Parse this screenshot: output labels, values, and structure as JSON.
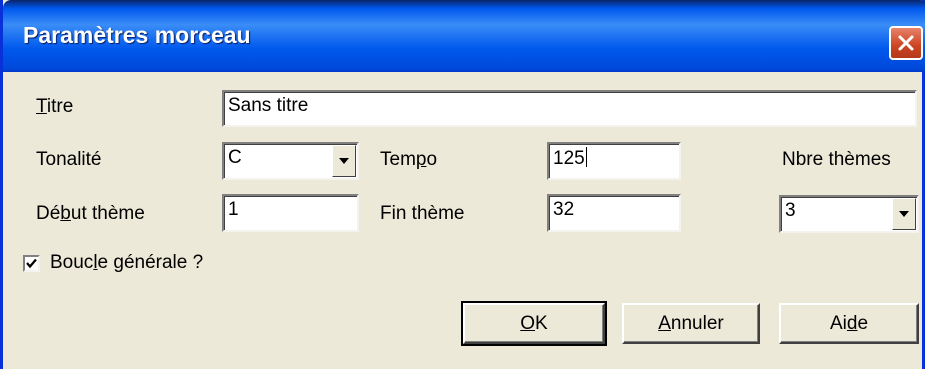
{
  "window": {
    "title": "Paramètres morceau"
  },
  "fields": {
    "titre": {
      "label_u": "T",
      "label_rest": "itre",
      "value": "Sans titre"
    },
    "tonalite": {
      "label": "Tonalité",
      "value": "C"
    },
    "tempo": {
      "label_pre": "Tem",
      "label_u": "p",
      "label_post": "o",
      "value": "125"
    },
    "nbre_themes": {
      "label": "Nbre thèmes",
      "value": "3"
    },
    "debut_theme": {
      "label_pre": "Dé",
      "label_u": "b",
      "label_post": "ut thème",
      "value": "1"
    },
    "fin_theme": {
      "label": "Fin thème",
      "value": "32"
    }
  },
  "boucle": {
    "label_pre": "Bouc",
    "label_u": "l",
    "label_post": "e générale ?",
    "checked": true
  },
  "buttons": {
    "ok": {
      "u": "O",
      "rest": "K"
    },
    "annuler": {
      "u": "A",
      "rest": "nnuler"
    },
    "aide": {
      "pre": "Ai",
      "u": "d",
      "post": "e"
    }
  },
  "icons": {
    "close": "close-icon",
    "dropdown": "chevron-down-icon",
    "check": "check-icon"
  },
  "colors": {
    "titlebar": "#0058ee",
    "close": "#cc4422",
    "dialog_bg": "#ece9d8"
  }
}
